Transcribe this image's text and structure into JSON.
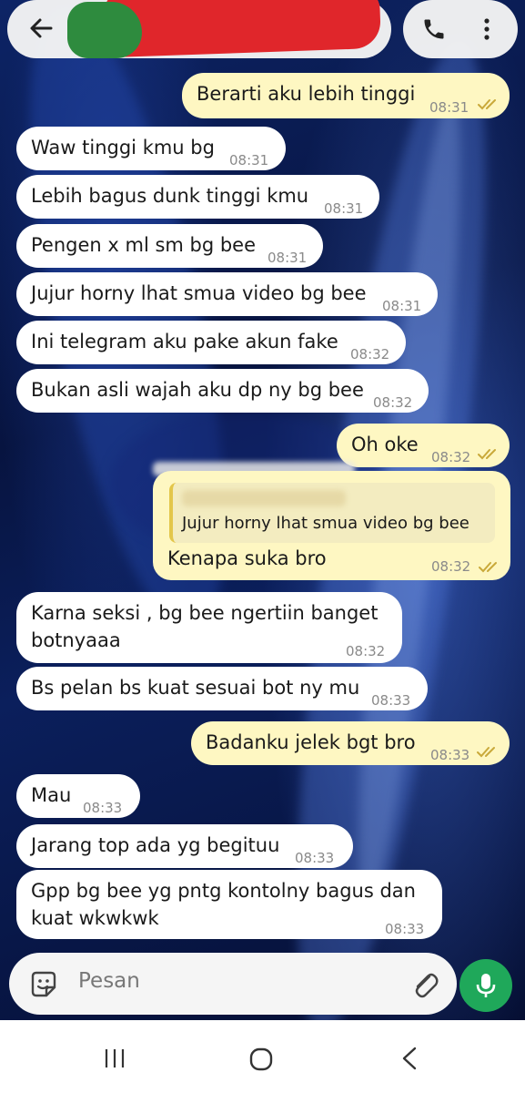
{
  "header": {
    "back_icon": "arrow-left-icon",
    "call_icon": "phone-icon",
    "menu_icon": "more-vertical-icon"
  },
  "messages": [
    {
      "dir": "out",
      "text": "Berarti aku lebih tinggi",
      "time": "08:31"
    },
    {
      "dir": "in",
      "text": "Waw tinggi kmu bg",
      "time": "08:31"
    },
    {
      "dir": "in",
      "text": "Lebih bagus dunk tinggi kmu",
      "time": "08:31"
    },
    {
      "dir": "in",
      "text": "Pengen x ml sm bg bee",
      "time": "08:31"
    },
    {
      "dir": "in",
      "text": "Jujur horny lhat smua video bg bee",
      "time": "08:31"
    },
    {
      "dir": "in",
      "text": "Ini telegram aku pake akun fake",
      "time": "08:32"
    },
    {
      "dir": "in",
      "text": "Bukan asli wajah aku dp ny bg bee",
      "time": "08:32"
    },
    {
      "dir": "out",
      "text": "Oh oke",
      "time": "08:32"
    },
    {
      "dir": "out",
      "quoted_text": "Jujur horny lhat smua video bg bee",
      "text": "Kenapa suka bro",
      "time": "08:32"
    },
    {
      "dir": "in",
      "text": "Karna seksi , bg bee ngertiin banget",
      "text2": "botnyaaa",
      "time": "08:32"
    },
    {
      "dir": "in",
      "text": "Bs pelan bs kuat sesuai bot ny mu",
      "time": "08:33"
    },
    {
      "dir": "out",
      "text": "Badanku jelek bgt bro",
      "time": "08:33"
    },
    {
      "dir": "in",
      "text": "Mau",
      "time": "08:33"
    },
    {
      "dir": "in",
      "text": "Jarang top ada yg begituu",
      "time": "08:33"
    },
    {
      "dir": "in",
      "text": "Gpp bg bee yg pntg kontolny bagus dan",
      "text2": "kuat wkwkwk",
      "time": "08:33"
    }
  ],
  "composer": {
    "placeholder": "Pesan",
    "sticker_icon": "sticker-icon",
    "attach_icon": "paperclip-icon",
    "mic_icon": "microphone-icon"
  },
  "navbar": {
    "recents_icon": "recent-apps-icon",
    "home_icon": "home-icon",
    "back_icon": "nav-back-icon"
  },
  "colors": {
    "outgoing_bubble": "#fef7c2",
    "incoming_bubble": "#ffffff",
    "read_ticks": "#c9a93a",
    "mic_button": "#1fa85a"
  }
}
